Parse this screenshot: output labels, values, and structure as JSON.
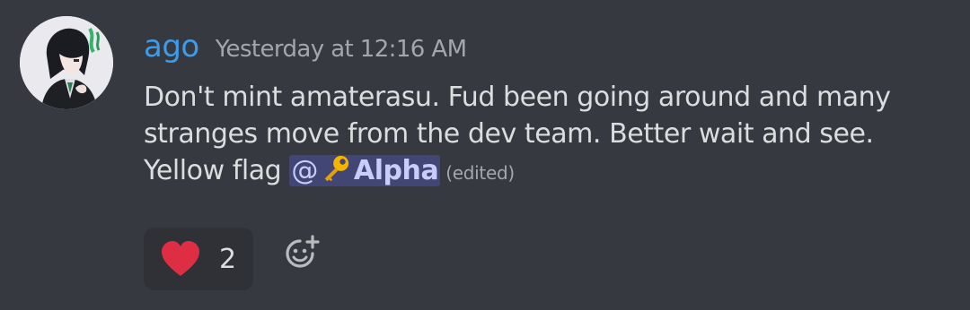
{
  "message": {
    "username": "ago",
    "timestamp": "Yesterday at 12:16 AM",
    "lines": [
      "Don't mint amaterasu. Fud been going around and many",
      "stranges move from the dev team. Better wait and see."
    ],
    "last_line_prefix": "Yellow flag ",
    "mention": {
      "at": "@",
      "name": "Alpha",
      "icon": "key-emoji-icon"
    },
    "edited_label": "(edited)"
  },
  "reactions": [
    {
      "emoji": "heart-emoji-icon",
      "count": "2",
      "color": "#dd2e44"
    }
  ],
  "colors": {
    "background": "#36393f",
    "username": "#3f9be8",
    "mention_bg": "#414674",
    "mention_text": "#c9cdfb"
  }
}
